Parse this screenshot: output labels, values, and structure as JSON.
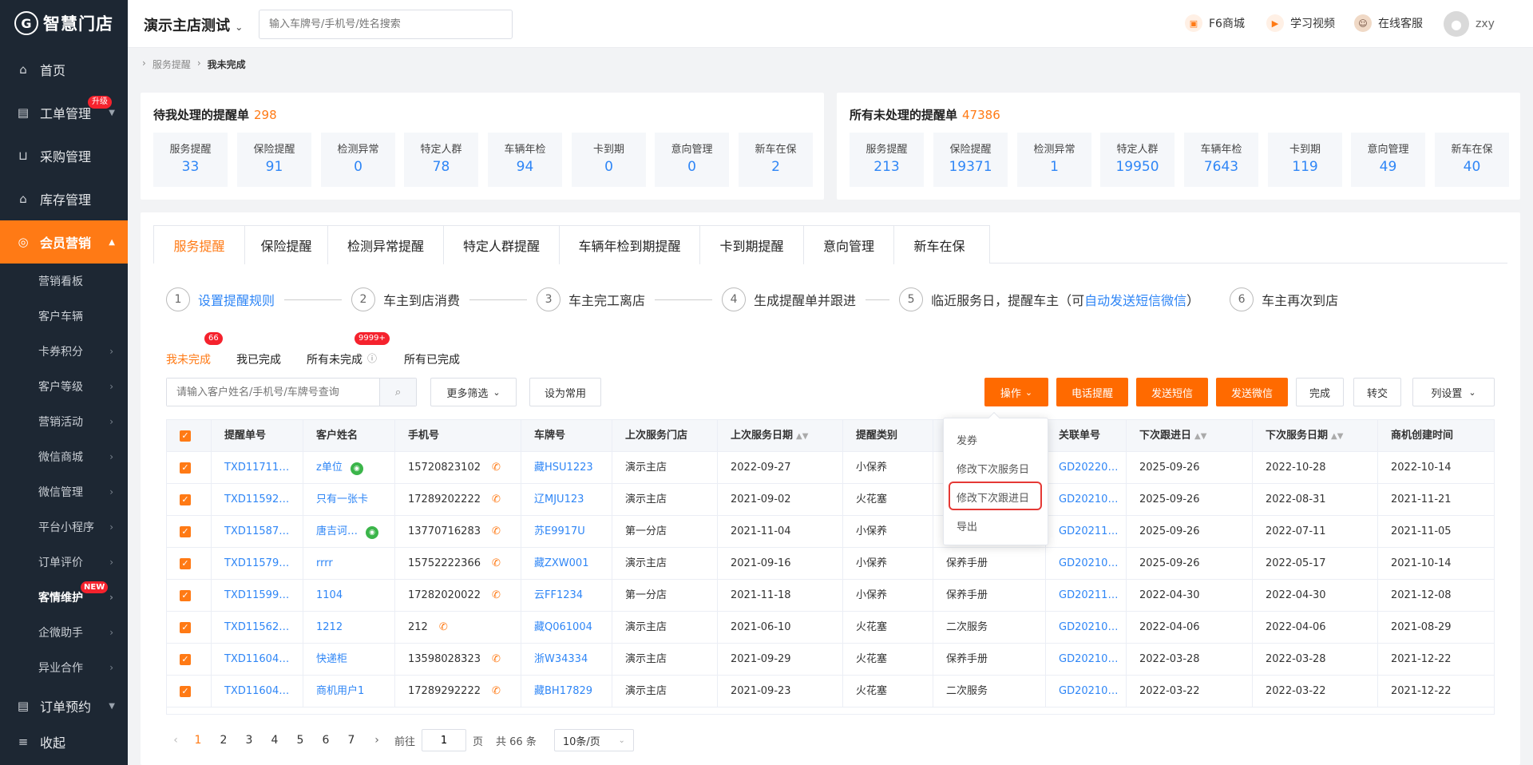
{
  "app": {
    "logo_text": "智慧门店"
  },
  "sidebar": {
    "top": [
      {
        "label": "首页",
        "icon": "home-icon"
      },
      {
        "label": "工单管理",
        "icon": "clipboard-icon",
        "badge": "升级"
      },
      {
        "label": "采购管理",
        "icon": "cart-icon"
      },
      {
        "label": "库存管理",
        "icon": "warehouse-icon"
      },
      {
        "label": "会员营销",
        "icon": "member-icon"
      }
    ],
    "sub": [
      "营销看板",
      "客户车辆",
      "卡券积分",
      "客户等级",
      "营销活动",
      "微信商城",
      "微信管理",
      "平台小程序",
      "订单评价",
      "客情维护",
      "企微助手",
      "异业合作"
    ],
    "sub_new_badge": "NEW",
    "bottom": [
      {
        "label": "订单预约",
        "icon": "order-icon"
      },
      {
        "label": "收起",
        "icon": "collapse-icon"
      }
    ]
  },
  "header": {
    "store": "演示主店测试",
    "search_placeholder": "输入车牌号/手机号/姓名搜索",
    "mall": "F6商城",
    "video": "学习视频",
    "service": "在线客服",
    "user": "zxy"
  },
  "breadcrumb": [
    "服务提醒",
    "我未完成"
  ],
  "stats_mine": {
    "title": "待我处理的提醒单",
    "total": "298",
    "items": [
      [
        "服务提醒",
        "33"
      ],
      [
        "保险提醒",
        "91"
      ],
      [
        "检测异常",
        "0"
      ],
      [
        "特定人群",
        "78"
      ],
      [
        "车辆年检",
        "94"
      ],
      [
        "卡到期",
        "0"
      ],
      [
        "意向管理",
        "0"
      ],
      [
        "新车在保",
        "2"
      ]
    ]
  },
  "stats_all": {
    "title": "所有未处理的提醒单",
    "total": "47386",
    "items": [
      [
        "服务提醒",
        "213"
      ],
      [
        "保险提醒",
        "19371"
      ],
      [
        "检测异常",
        "1"
      ],
      [
        "特定人群",
        "19950"
      ],
      [
        "车辆年检",
        "7643"
      ],
      [
        "卡到期",
        "119"
      ],
      [
        "意向管理",
        "49"
      ],
      [
        "新车在保",
        "40"
      ]
    ]
  },
  "tabs": [
    "服务提醒",
    "保险提醒",
    "检测异常提醒",
    "特定人群提醒",
    "车辆年检到期提醒",
    "卡到期提醒",
    "意向管理",
    "新车在保"
  ],
  "steps": {
    "s1": "设置提醒规则",
    "s2": "车主到店消费",
    "s3": "车主完工离店",
    "s4": "生成提醒单并跟进",
    "s5a": "临近服务日，提醒车主（可",
    "s5link": "自动发送短信微信",
    "s5b": "）",
    "s6": "车主再次到店"
  },
  "subtabs": [
    {
      "label": "我未完成",
      "badge": "66"
    },
    {
      "label": "我已完成"
    },
    {
      "label": "所有未完成",
      "badge": "9999+"
    },
    {
      "label": "所有已完成"
    }
  ],
  "toolbar": {
    "search_placeholder": "请输入客户姓名/手机号/车牌号查询",
    "more_filter": "更多筛选",
    "set_common": "设为常用",
    "operate": "操作",
    "phone_remind": "电话提醒",
    "send_sms": "发送短信",
    "send_wx": "发送微信",
    "done": "完成",
    "transfer": "转交",
    "col_setting": "列设置"
  },
  "dropdown": [
    "发券",
    "修改下次服务日",
    "修改下次跟进日",
    "导出"
  ],
  "table": {
    "headers": [
      "提醒单号",
      "客户姓名",
      "手机号",
      "车牌号",
      "上次服务门店",
      "上次服务日期",
      "提醒类别",
      "",
      "关联单号",
      "下次跟进日",
      "下次服务日期",
      "商机创建时间"
    ],
    "rows": [
      [
        "TXD11711…",
        "z单位",
        "15720823102",
        "藏HSU1223",
        "演示主店",
        "2022-09-27",
        "小保养",
        "",
        "GD20220…",
        "2025-09-26",
        "2022-10-28",
        "2022-10-14"
      ],
      [
        "TXD11592…",
        "只有一张卡",
        "17289202222",
        "辽MJU123",
        "演示主店",
        "2021-09-02",
        "火花塞",
        "",
        "GD20210…",
        "2025-09-26",
        "2022-08-31",
        "2021-11-21"
      ],
      [
        "TXD11587…",
        "唐吉诃…",
        "13770716283",
        "苏E9917U",
        "第一分店",
        "2021-11-04",
        "小保养",
        "",
        "GD20211…",
        "2025-09-26",
        "2022-07-11",
        "2021-11-05"
      ],
      [
        "TXD11579…",
        "rrrr",
        "15752222366",
        "藏ZXW001",
        "演示主店",
        "2021-09-16",
        "小保养",
        "保养手册",
        "GD20210…",
        "2025-09-26",
        "2022-05-17",
        "2021-10-14"
      ],
      [
        "TXD11599…",
        "1104",
        "17282020022",
        "云FF1234",
        "第一分店",
        "2021-11-18",
        "小保养",
        "保养手册",
        "GD20211…",
        "2022-04-30",
        "2022-04-30",
        "2021-12-08"
      ],
      [
        "TXD11562…",
        "1212",
        "212",
        "藏Q061004",
        "演示主店",
        "2021-06-10",
        "火花塞",
        "二次服务",
        "GD20210…",
        "2022-04-06",
        "2022-04-06",
        "2021-08-29"
      ],
      [
        "TXD11604…",
        "快递柜",
        "13598028323",
        "浙W34334",
        "演示主店",
        "2021-09-29",
        "火花塞",
        "保养手册",
        "GD20210…",
        "2022-03-28",
        "2022-03-28",
        "2021-12-22"
      ],
      [
        "TXD11604…",
        "商机用户1",
        "17289292222",
        "藏BH17829",
        "演示主店",
        "2021-09-23",
        "火花塞",
        "二次服务",
        "GD20210…",
        "2022-03-22",
        "2022-03-22",
        "2021-12-22"
      ]
    ],
    "wx_rows": [
      0,
      2
    ]
  },
  "pagination": {
    "prev": "‹",
    "next": "›",
    "pages": [
      "1",
      "2",
      "3",
      "4",
      "5",
      "6",
      "7"
    ],
    "goto_label": "前往",
    "goto_value": "1",
    "page_unit": "页",
    "total": "共 66 条",
    "page_size": "10条/页"
  },
  "colors": {
    "accent": "#ff7a15",
    "link": "#2f86f6",
    "sidebar": "#1d2733"
  }
}
